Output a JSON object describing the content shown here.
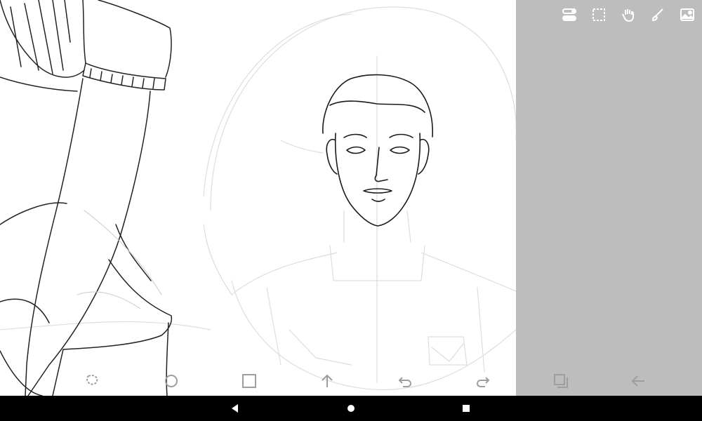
{
  "canvas": {
    "artwork": "sketch-canvas"
  },
  "top_toolbar": {
    "items": [
      {
        "icon": "layers-toggle-icon"
      },
      {
        "icon": "selection-icon"
      },
      {
        "icon": "hand-tool-icon"
      },
      {
        "icon": "brush-icon"
      },
      {
        "icon": "image-icon"
      }
    ]
  },
  "bottom_toolbar": {
    "items": [
      {
        "icon": "lasso-icon"
      },
      {
        "icon": "ellipse-icon"
      },
      {
        "icon": "rectangle-icon"
      },
      {
        "icon": "arrow-up-icon"
      },
      {
        "icon": "undo-icon"
      },
      {
        "icon": "redo-icon"
      }
    ]
  },
  "side_panel": {
    "items": [
      {
        "icon": "layers-icon"
      },
      {
        "icon": "back-arrow-icon"
      }
    ]
  },
  "system_nav": {
    "items": [
      {
        "icon": "back-triangle-icon"
      },
      {
        "icon": "home-circle-icon"
      },
      {
        "icon": "recents-square-icon"
      }
    ]
  },
  "colors": {
    "panel": "#bdbdbd",
    "icon_gray": "#9e9e9e",
    "icon_light": "#ffffff",
    "nav_bar": "#000000"
  }
}
